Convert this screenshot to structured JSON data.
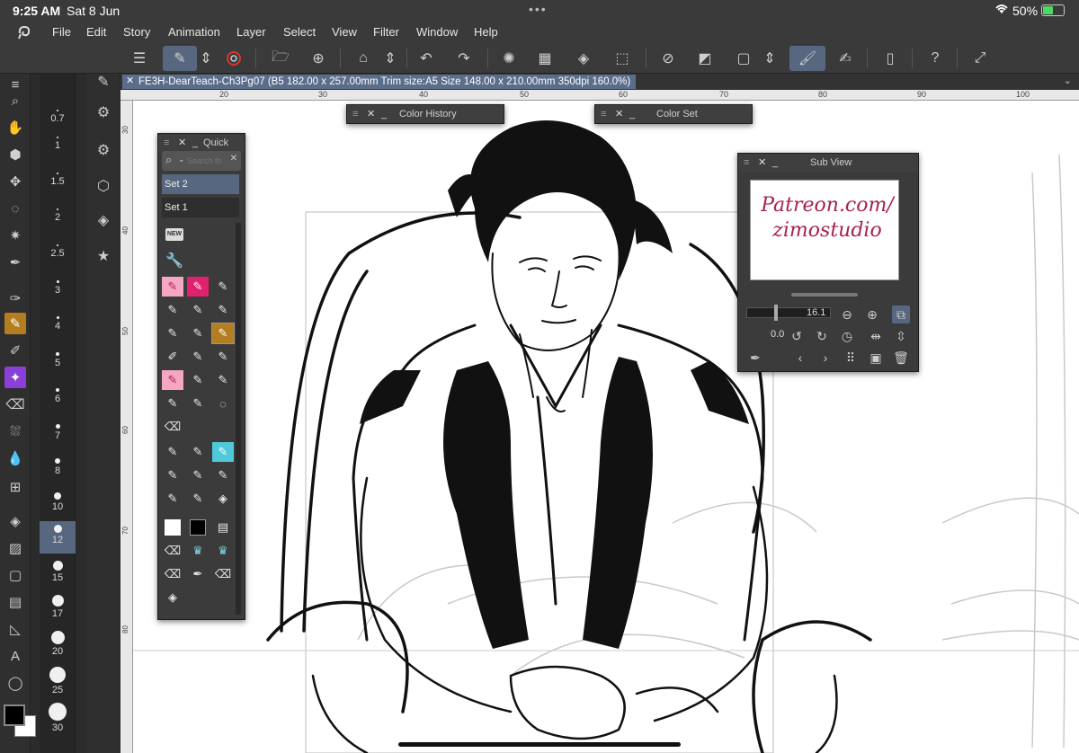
{
  "status_bar": {
    "time": "9:25 AM",
    "date": "Sat 8 Jun",
    "battery": "50%",
    "wifi_icon": "wifi-icon",
    "dots": "•••"
  },
  "menubar": {
    "items": [
      "File",
      "Edit",
      "Story",
      "Animation",
      "Layer",
      "Select",
      "View",
      "Filter",
      "Window",
      "Help"
    ]
  },
  "document_tab": {
    "title": "FE3H-DearTeach-Ch3Pg07 (B5 182.00 x 257.00mm Trim size:A5 Size 148.00 x 210.00mm 350dpi 160.0%)",
    "close": "✕"
  },
  "ruler": {
    "top_ticks": [
      "20",
      "30",
      "40",
      "50",
      "60",
      "70",
      "80",
      "90",
      "100"
    ],
    "left_ticks": [
      "30",
      "40",
      "50",
      "60",
      "70",
      "80"
    ]
  },
  "brush_sizes": [
    "0.7",
    "1",
    "1.5",
    "2",
    "2.5",
    "3",
    "4",
    "5",
    "6",
    "7",
    "8",
    "10",
    "12",
    "15",
    "17",
    "20",
    "25",
    "30"
  ],
  "brush_selected": "12",
  "panels": {
    "quick_access": {
      "title": "Quick Acc",
      "search_placeholder": "Search fo",
      "sets": [
        "Set 2",
        "Set 1"
      ],
      "new_badge": "NEW"
    },
    "color_history": {
      "title": "Color History"
    },
    "color_set": {
      "title": "Color Set"
    },
    "sub_view": {
      "title": "Sub View",
      "preview_line1": "Patreon.com/",
      "preview_line2": "zimostudio",
      "zoom_value": "16.1",
      "rotation_value": "0.0"
    }
  },
  "colors": {
    "accent": "#56677f",
    "active_tool": "#b37d20",
    "purple_tool": "#8a3fd6",
    "watermark": "#a8204f"
  }
}
